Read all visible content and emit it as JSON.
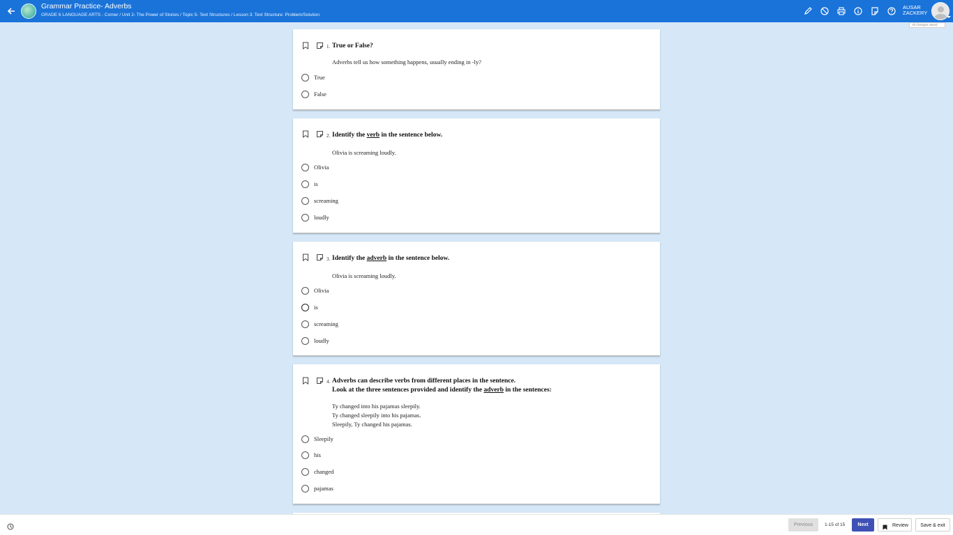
{
  "header": {
    "title": "Grammar Practice- Adverbs",
    "breadcrumb": "GRADE 6 LANGUAGE ARTS - Comer / Unit 2- The Power of Stories / Topic 5- Text Structures / Lesson 3: Text Structure: Problem/Solution",
    "user_first": "AUSAR",
    "user_last": "ZACKERY",
    "save_status": "All changes saved",
    "tools": [
      "pencil-icon",
      "eliminator-icon",
      "print-icon",
      "info-icon",
      "notepad-icon",
      "help-icon"
    ]
  },
  "questions": [
    {
      "number": "1.",
      "text": "True or False?",
      "prompt": [
        "Adverbs tell us how something happens, usually ending in -ly?"
      ],
      "options": [
        "True",
        "False"
      ]
    },
    {
      "number": "2.",
      "text_before": "Identify the ",
      "text_underlined": "verb",
      "text_after": " in the sentence below.",
      "prompt": [
        "Olivia is screaming loudly."
      ],
      "options": [
        "Olivia",
        "is",
        "screaming",
        "loudly"
      ]
    },
    {
      "number": "3.",
      "text_before": "Identify the ",
      "text_underlined": "adverb",
      "text_after": " in the sentence below.",
      "prompt": [
        "Olivia is screaming loudly."
      ],
      "options": [
        "Olivia",
        "is",
        "screaming",
        "loudly"
      ]
    },
    {
      "number": "4.",
      "text_line1": "Adverbs can describe verbs from different places in the sentence.",
      "text_before": "Look at the three sentences provided and identify the ",
      "text_underlined": "adverb",
      "text_after": " in the sentences:",
      "prompt": [
        "Ty changed into his pajamas sleepily.",
        "Ty changed sleepily into his pajamas.",
        "Sleepily, Ty changed his pajamas."
      ],
      "options": [
        "Sleepily",
        "his",
        "changed",
        "pajamas"
      ]
    }
  ],
  "footer": {
    "previous_label": "Previous",
    "counter": "1-15 of 15",
    "next_label": "Next",
    "review_label": "Review",
    "save_exit_label": "Save & exit"
  },
  "colors": {
    "header_bg": "#1a73d9",
    "page_bg": "#d6e8f8",
    "next_button": "#3f51b5"
  }
}
